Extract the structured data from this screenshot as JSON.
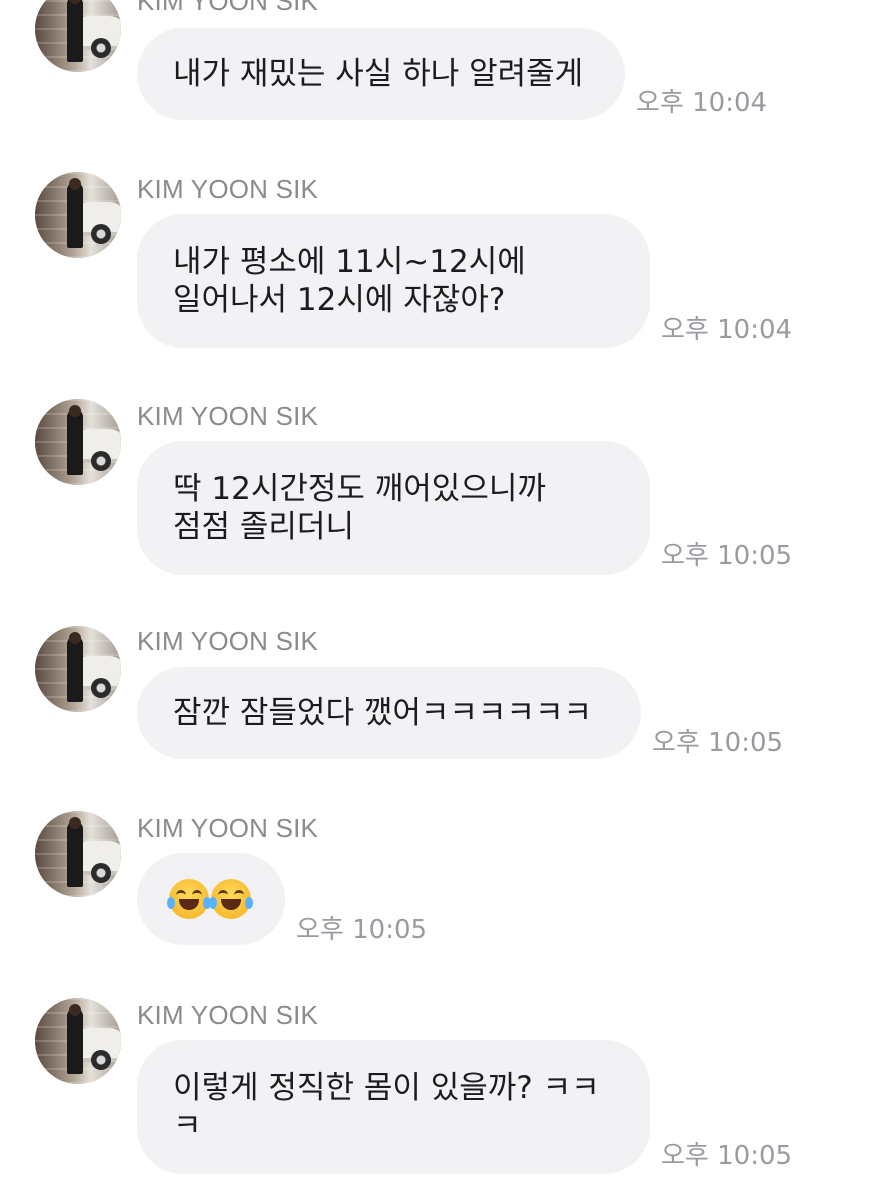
{
  "chat": {
    "messages": [
      {
        "sender": "KIM YOON SIK",
        "lines": [
          "내가 재밌는 사실 하나 알려줄게"
        ],
        "time": "오후 10:04"
      },
      {
        "sender": "KIM YOON SIK",
        "lines": [
          "내가 평소에 11시~12시에",
          "일어나서 12시에 자잖아?"
        ],
        "time": "오후 10:04"
      },
      {
        "sender": "KIM YOON SIK",
        "lines": [
          "딱 12시간정도 깨어있으니까",
          "점점 졸리더니"
        ],
        "time": "오후 10:05"
      },
      {
        "sender": "KIM YOON SIK",
        "lines": [
          "잠깐 잠들었다 깼어ㅋㅋㅋㅋㅋㅋ"
        ],
        "time": "오후 10:05"
      },
      {
        "sender": "KIM YOON SIK",
        "emoji": [
          "tears-of-joy-icon",
          "tears-of-joy-icon"
        ],
        "time": "오후 10:05"
      },
      {
        "sender": "KIM YOON SIK",
        "lines": [
          "이렇게 정직한 몸이 있을까? ㅋㅋ",
          "ㅋ"
        ],
        "time": "오후 10:05"
      }
    ]
  }
}
